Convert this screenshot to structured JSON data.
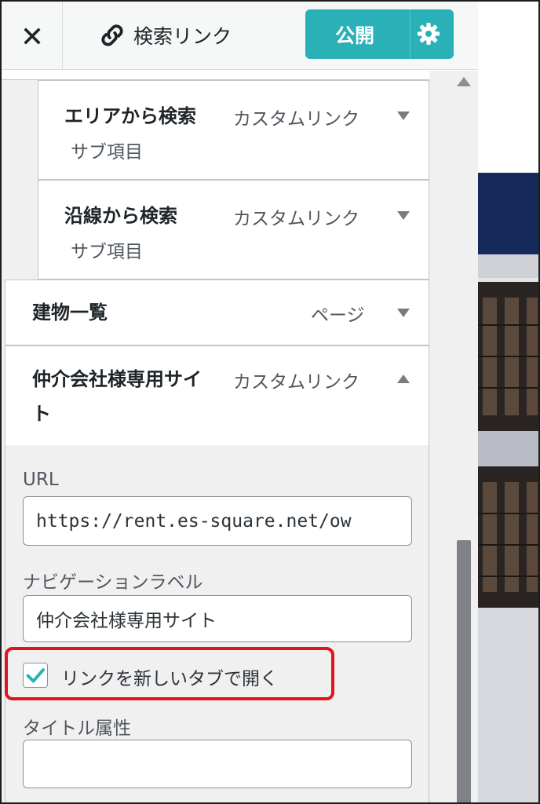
{
  "header": {
    "close_icon": "close-icon",
    "title": "検索リンク",
    "title_icon": "link-icon",
    "publish_label": "公開",
    "settings_icon": "gear-icon",
    "publish_color": "#2ab1b7"
  },
  "menu_items": [
    {
      "title": "エリアから検索",
      "subtitle": "サブ項目",
      "type": "カスタムリンク"
    },
    {
      "title": "沿線から検索",
      "subtitle": "サブ項目",
      "type": "カスタムリンク"
    },
    {
      "title": "建物一覧",
      "type": "ページ"
    },
    {
      "title_line1": "仲介会社様専用サイ",
      "title_line2": "ト",
      "type": "カスタムリンク"
    }
  ],
  "settings": {
    "url_label": "URL",
    "url_value": "https://rent.es-square.net/ow",
    "nav_label_label": "ナビゲーションラベル",
    "nav_label_value": "仲介会社様専用サイト",
    "new_tab_label": "リンクを新しいタブで開く",
    "new_tab_checked": true,
    "title_attr_label": "タイトル属性",
    "title_attr_value": ""
  },
  "highlight_color": "#e0141e"
}
